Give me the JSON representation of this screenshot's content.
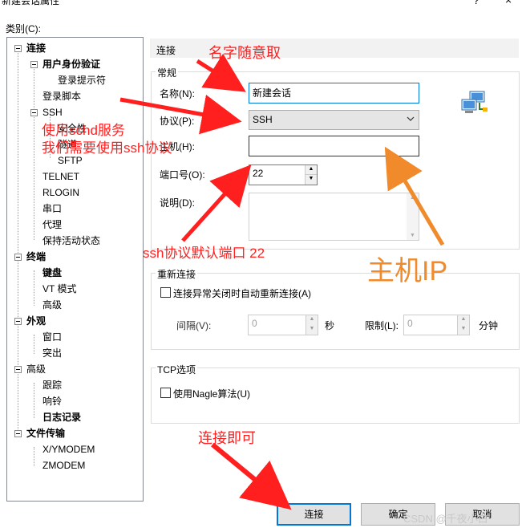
{
  "window": {
    "title": "新建会话属性",
    "help_glyph": "?",
    "close_glyph": "×"
  },
  "category_label": "类别(C):",
  "tree": [
    {
      "label": "连接",
      "bold": true
    },
    {
      "label": "用户身份验证",
      "bold": true
    },
    {
      "label": "登录提示符",
      "bold": false
    },
    {
      "label": "登录脚本",
      "bold": false
    },
    {
      "label": "SSH",
      "bold": false
    },
    {
      "label": "安全性",
      "bold": false
    },
    {
      "label": "隧道",
      "bold": false
    },
    {
      "label": "SFTP",
      "bold": false
    },
    {
      "label": "TELNET",
      "bold": false
    },
    {
      "label": "RLOGIN",
      "bold": false
    },
    {
      "label": "串口",
      "bold": false
    },
    {
      "label": "代理",
      "bold": false
    },
    {
      "label": "保持活动状态",
      "bold": false
    },
    {
      "label": "终端",
      "bold": true
    },
    {
      "label": "键盘",
      "bold": true
    },
    {
      "label": "VT 模式",
      "bold": false
    },
    {
      "label": "高级",
      "bold": false
    },
    {
      "label": "外观",
      "bold": true
    },
    {
      "label": "窗口",
      "bold": false
    },
    {
      "label": "突出",
      "bold": false
    },
    {
      "label": "高级",
      "bold": false
    },
    {
      "label": "跟踪",
      "bold": false
    },
    {
      "label": "响铃",
      "bold": false
    },
    {
      "label": "日志记录",
      "bold": true
    },
    {
      "label": "文件传输",
      "bold": true
    },
    {
      "label": "X/YMODEM",
      "bold": false
    },
    {
      "label": "ZMODEM",
      "bold": false
    }
  ],
  "section_header": "连接",
  "general": {
    "title": "常规",
    "name_label": "名称(N):",
    "name_value": "新建会话",
    "protocol_label": "协议(P):",
    "protocol_value": "SSH",
    "host_label": "主机(H):",
    "host_value": "",
    "port_label": "端口号(O):",
    "port_value": "22",
    "desc_label": "说明(D):",
    "desc_value": ""
  },
  "reconnect": {
    "title": "重新连接",
    "checkbox_label": "连接异常关闭时自动重新连接(A)",
    "interval_label": "间隔(V):",
    "interval_value": "0",
    "seconds_unit": "秒",
    "limit_label": "限制(L):",
    "limit_value": "0",
    "minutes_unit": "分钟"
  },
  "tcp": {
    "title": "TCP选项",
    "nagle_label": "使用Nagle算法(U)"
  },
  "buttons": {
    "connect": "连接",
    "ok": "确定",
    "cancel": "取消"
  },
  "annotations": {
    "name_note": "名字随意取",
    "protocol_note_1": "使用schd服务",
    "protocol_note_2": "我们需要使用ssh协议",
    "port_note": "ssh协议默认端口 22",
    "host_note": "主机IP",
    "connect_note": "连接即可",
    "accent_red": "#ff1f1f",
    "accent_orange": "#f08a2a"
  },
  "watermark": "CSDN @千夜小白"
}
